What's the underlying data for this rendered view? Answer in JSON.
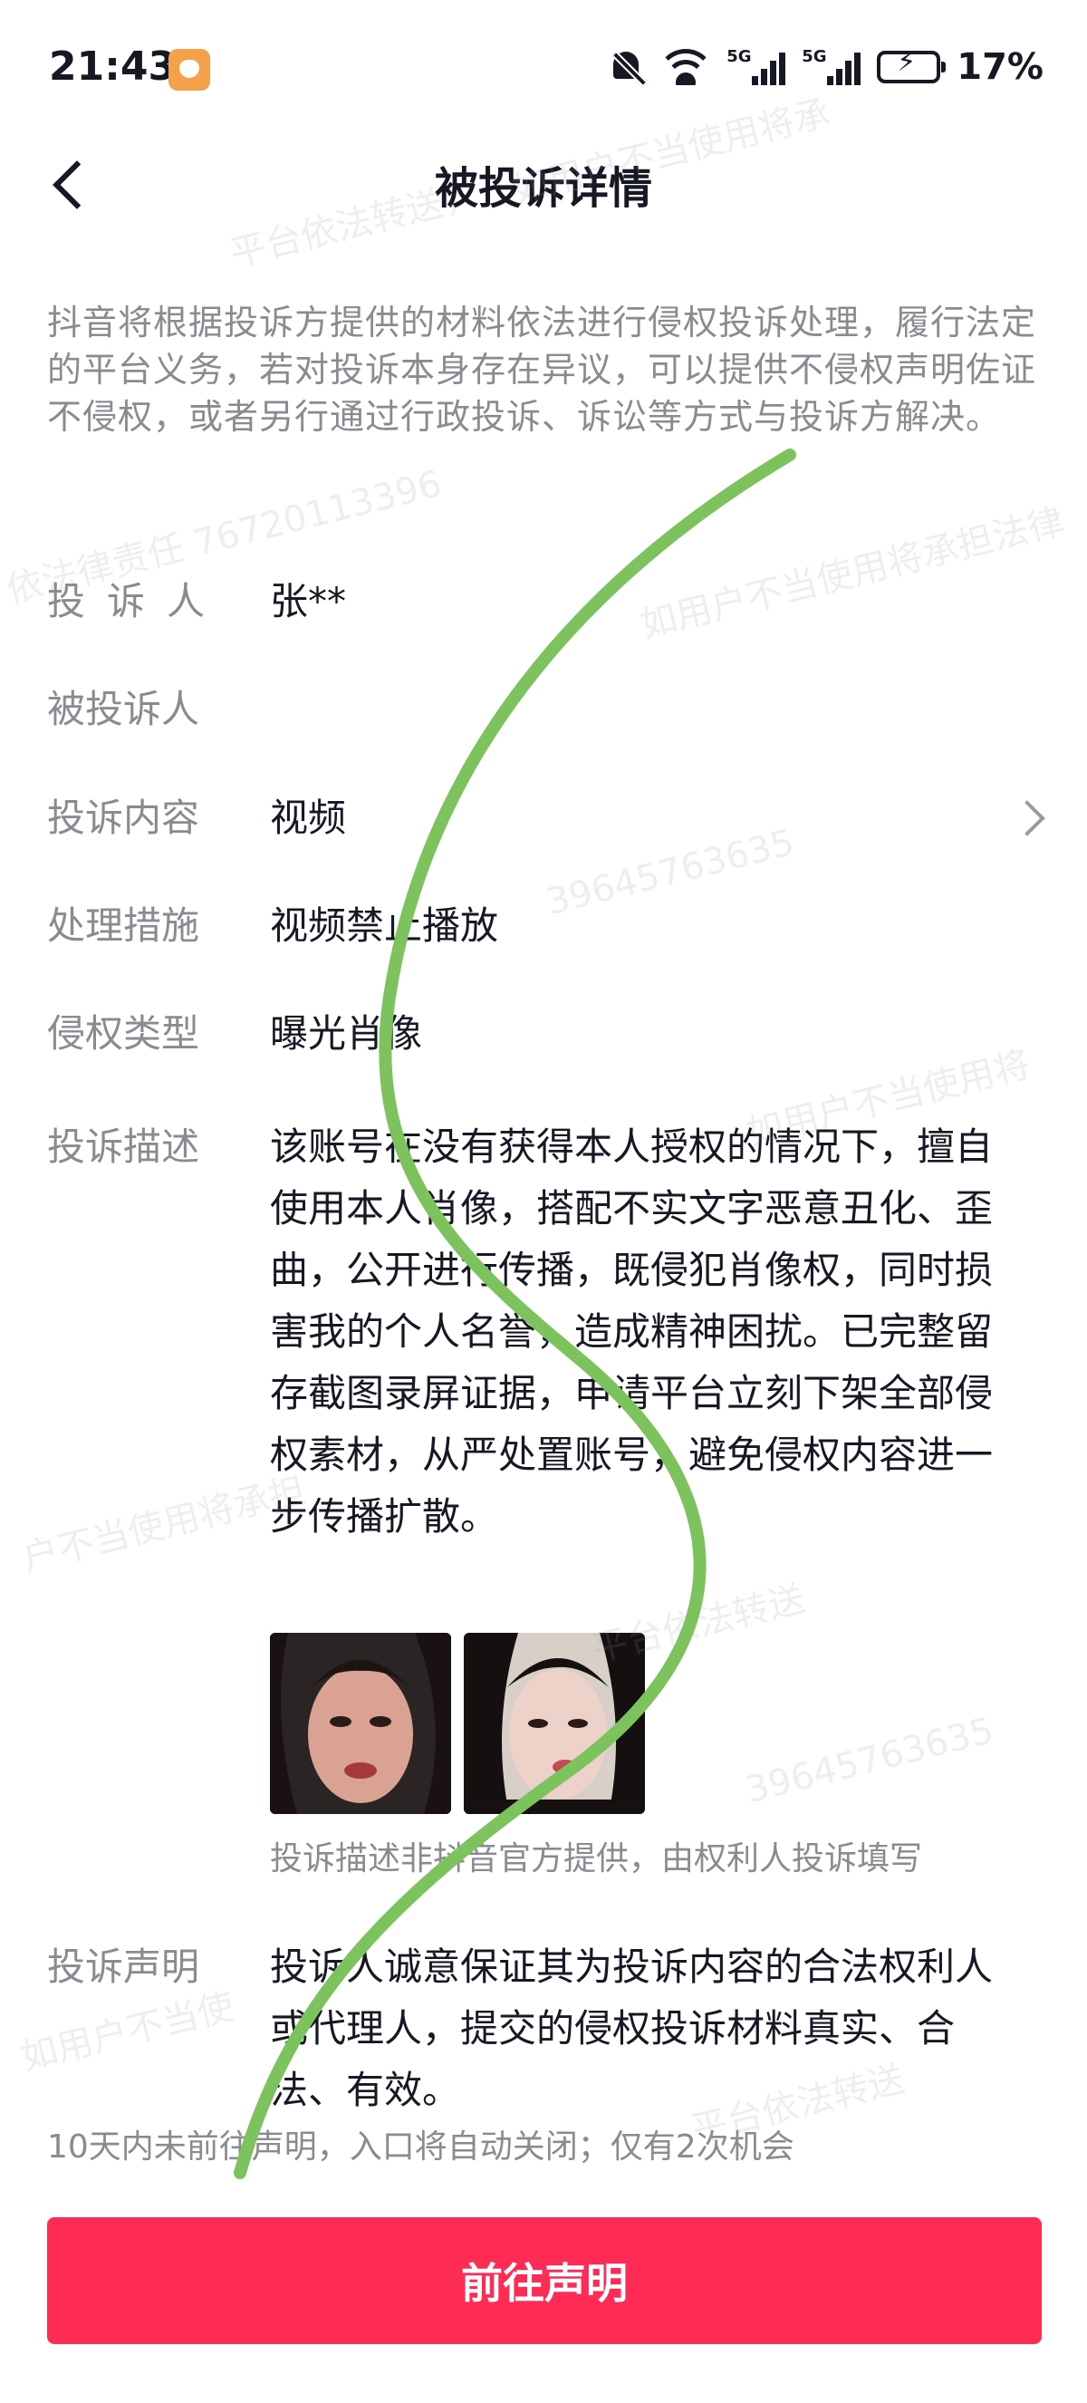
{
  "status_bar": {
    "time": "21:43",
    "sig1_label": "5G",
    "sig2_label": "5G",
    "battery": "17%",
    "icons": [
      "app-notification-icon",
      "mute-bell-icon",
      "wifi-icon",
      "signal-5g-icon",
      "signal-5g-icon",
      "battery-charging-icon"
    ]
  },
  "header": {
    "title": "被投诉详情",
    "back_icon": "chevron-left-icon"
  },
  "intro": "抖音将根据投诉方提供的材料依法进行侵权投诉处理，履行法定的平台义务，若对投诉本身存在异议，可以提供不侵权声明佐证不侵权，或者另行通过行政投诉、诉讼等方式与投诉方解决。",
  "fields": {
    "complainant": {
      "label": "投诉人",
      "value": "张**"
    },
    "respondent": {
      "label": "被投诉人",
      "value": ""
    },
    "content": {
      "label": "投诉内容",
      "value": "视频"
    },
    "measure": {
      "label": "处理措施",
      "value": "视频禁止播放"
    },
    "type": {
      "label": "侵权类型",
      "value": "曝光肖像"
    },
    "description": {
      "label": "投诉描述",
      "value": "该账号在没有获得本人授权的情况下，擅自使用本人肖像，搭配不实文字恶意丑化、歪曲，公开进行传播，既侵犯肖像权，同时损害我的个人名誉，造成精神困扰。已完整留存截图录屏证据，申请平台立刻下架全部侵权素材，从严处置账号，避免侵权内容进一步传播扩散。"
    },
    "description_note": "投诉描述非抖音官方提供，由权利人投诉填写",
    "statement": {
      "label": "投诉声明",
      "value": "投诉人诚意保证其为投诉内容的合法权利人或代理人，提交的侵权投诉材料真实、合法、有效。"
    }
  },
  "footnote": "10天内未前往声明，入口将自动关闭；仅有2次机会",
  "cta_label": "前往声明",
  "watermarks": [
    "平台依法转送，",
    "如用户不当使用将承",
    "依法律责任 76720113396",
    "如用户不当使用将承担法律",
    "39645763635",
    "如用户不当使用将",
    "户不当使用将承担",
    "平台依法转送",
    "39645763635",
    "如用户不当使",
    "平台依法转送"
  ],
  "colors": {
    "accent": "#fe2c55",
    "annotation_line": "#7cc35e",
    "muted_text": "#8a8b91"
  }
}
